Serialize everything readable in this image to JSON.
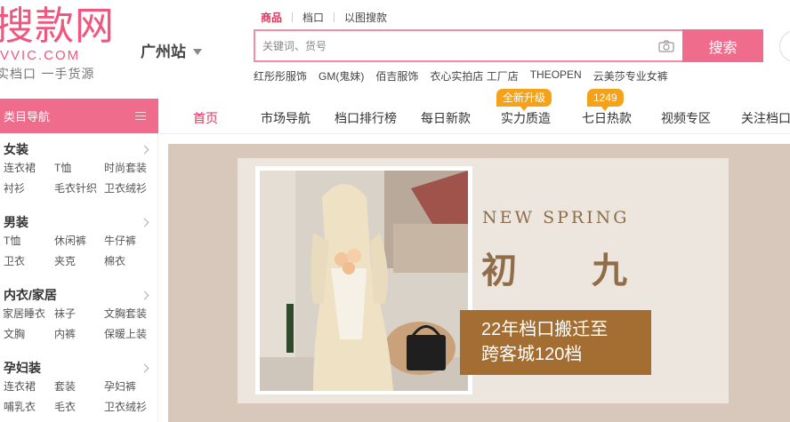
{
  "logo": {
    "main": "搜款网",
    "domain": "VVIC.COM",
    "slogan": "实档口 一手货源"
  },
  "city": {
    "name": "广州站"
  },
  "search": {
    "tabs": [
      "商品",
      "档口",
      "以图搜款"
    ],
    "active_tab": "商品",
    "placeholder": "关键词、货号",
    "button_label": "搜索",
    "hot_keywords": [
      "红彤彤服饰",
      "GM(鬼妹)",
      "佰吉服饰",
      "衣心实拍店 工厂店",
      "THEOPEN",
      "云美莎专业女裤"
    ]
  },
  "category_nav": {
    "title": "类目导航",
    "groups": [
      {
        "title": "女装",
        "rows": [
          [
            "连衣裙",
            "T恤",
            "时尚套装"
          ],
          [
            "衬衫",
            "毛衣针织",
            "卫衣绒衫"
          ]
        ]
      },
      {
        "title": "男装",
        "rows": [
          [
            "T恤",
            "休闲裤",
            "牛仔裤"
          ],
          [
            "卫衣",
            "夹克",
            "棉衣"
          ]
        ]
      },
      {
        "title": "内衣/家居",
        "rows": [
          [
            "家居睡衣",
            "袜子",
            "文胸套装"
          ],
          [
            "文胸",
            "内裤",
            "保暖上装"
          ]
        ]
      },
      {
        "title": "孕妇装",
        "rows": [
          [
            "连衣裙",
            "套装",
            "孕妇裤"
          ],
          [
            "哺乳衣",
            "毛衣",
            "卫衣绒衫"
          ]
        ]
      }
    ]
  },
  "main_nav": {
    "items": [
      {
        "label": "首页",
        "active": true
      },
      {
        "label": "市场导航"
      },
      {
        "label": "档口排行榜"
      },
      {
        "label": "每日新款"
      },
      {
        "label": "实力质造",
        "badge": "全新升级"
      },
      {
        "label": "七日热款",
        "badge": "1249"
      },
      {
        "label": "视频专区"
      },
      {
        "label": "关注档口"
      }
    ]
  },
  "banner": {
    "eng_title": "NEW SPRING",
    "cn_title": "初九",
    "notice_line1": "22年档口搬迁至",
    "notice_line2": "跨客城120档"
  },
  "colors": {
    "brand_pink": "#f06c8d",
    "active_red": "#e0335c",
    "badge_orange": "#f5a21b",
    "banner_brown": "#a46d32",
    "banner_text": "#8f6d49"
  }
}
